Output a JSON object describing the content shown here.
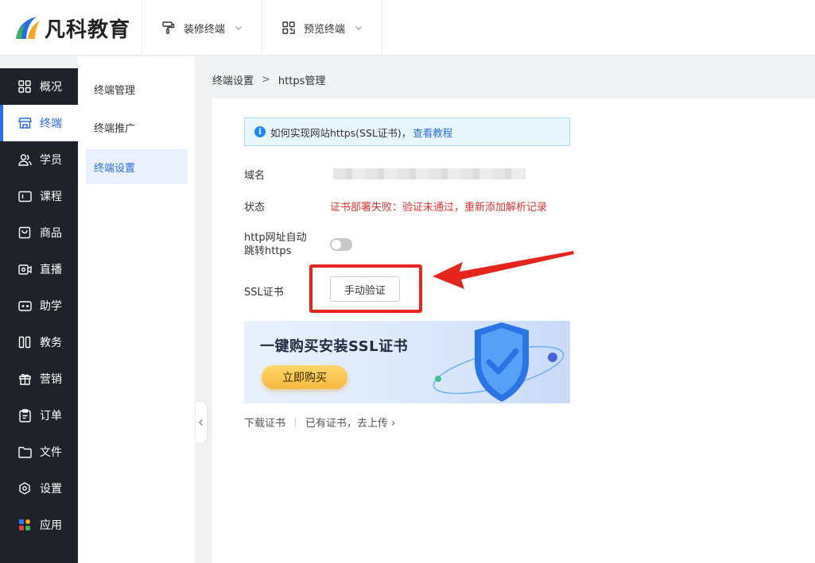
{
  "brand": {
    "name": "凡科教育"
  },
  "top_menu": [
    {
      "label": "装修终端",
      "icon": "paint-roller-icon"
    },
    {
      "label": "预览终端",
      "icon": "qr-code-icon"
    }
  ],
  "sidebar": {
    "items": [
      {
        "label": "概况",
        "icon": "dashboard-grid-icon"
      },
      {
        "label": "终端",
        "icon": "storefront-icon",
        "active": true
      },
      {
        "label": "学员",
        "icon": "users-icon"
      },
      {
        "label": "课程",
        "icon": "course-icon"
      },
      {
        "label": "商品",
        "icon": "bag-icon"
      },
      {
        "label": "直播",
        "icon": "live-camera-icon"
      },
      {
        "label": "助学",
        "icon": "gamepad-icon"
      },
      {
        "label": "教务",
        "icon": "columns-icon"
      },
      {
        "label": "营销",
        "icon": "gift-icon"
      },
      {
        "label": "订单",
        "icon": "clipboard-icon"
      },
      {
        "label": "文件",
        "icon": "folder-icon"
      },
      {
        "label": "设置",
        "icon": "gear-icon"
      },
      {
        "label": "应用",
        "icon": "apps-icon"
      }
    ]
  },
  "subnav": {
    "items": [
      {
        "label": "终端管理"
      },
      {
        "label": "终端推广"
      },
      {
        "label": "终端设置",
        "active": true
      }
    ]
  },
  "breadcrumb": {
    "parent": "终端设置",
    "separator": ">",
    "current": "https管理"
  },
  "notice": {
    "text": "如何实现网站https(SSL证书)，",
    "link": "查看教程"
  },
  "form": {
    "domain_label": "域名",
    "status_label": "状态",
    "status_value": "证书部署失败：验证未通过，重新添加解析记录",
    "redirect_label_line1": "http网址自动",
    "redirect_label_line2": "跳转https",
    "redirect_enabled": false,
    "ssl_label": "SSL证书",
    "verify_button": "手动验证"
  },
  "banner": {
    "title": "一键购买安装SSL证书",
    "button": "立即购买"
  },
  "links": {
    "download": "下载证书",
    "upload": "已有证书，去上传 ›"
  },
  "colors": {
    "accent": "#2b6de5",
    "error": "#e03333",
    "sidebar_bg": "#1f2329",
    "annotation_red": "#e4241d"
  }
}
